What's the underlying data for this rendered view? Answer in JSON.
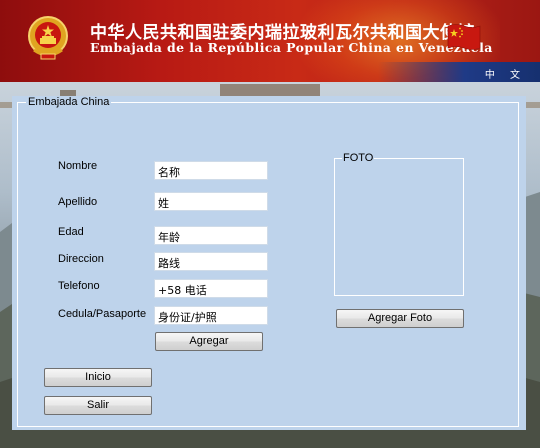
{
  "header": {
    "title_cn": "中华人民共和国驻委内瑞拉玻利瓦尔共和国大使馆",
    "title_es": "Embajada de la República Popular China en Venezuela",
    "language_link": "中 文",
    "emblem_icon": "national-emblem-icon",
    "flag_icon": "china-flag-icon",
    "brand_red": "#b81a14",
    "strip_blue": "#1f3a86"
  },
  "form": {
    "group_title": "Embajada China",
    "fields": [
      {
        "label": "Nombre",
        "value": "名称"
      },
      {
        "label": "Apellido",
        "value": "姓"
      },
      {
        "label": "Edad",
        "value": "年龄"
      },
      {
        "label": "Direccion",
        "value": "路线"
      },
      {
        "label": "Telefono",
        "value": "+58  电话"
      },
      {
        "label": "Cedula/Pasaporte",
        "value": "身份证/护照"
      }
    ],
    "add_button": "Agregar",
    "photo_title": "FOTO",
    "add_photo_button": "Agregar Foto",
    "home_button": "Inicio",
    "exit_button": "Salir",
    "panel_color": "#bed3eb"
  }
}
